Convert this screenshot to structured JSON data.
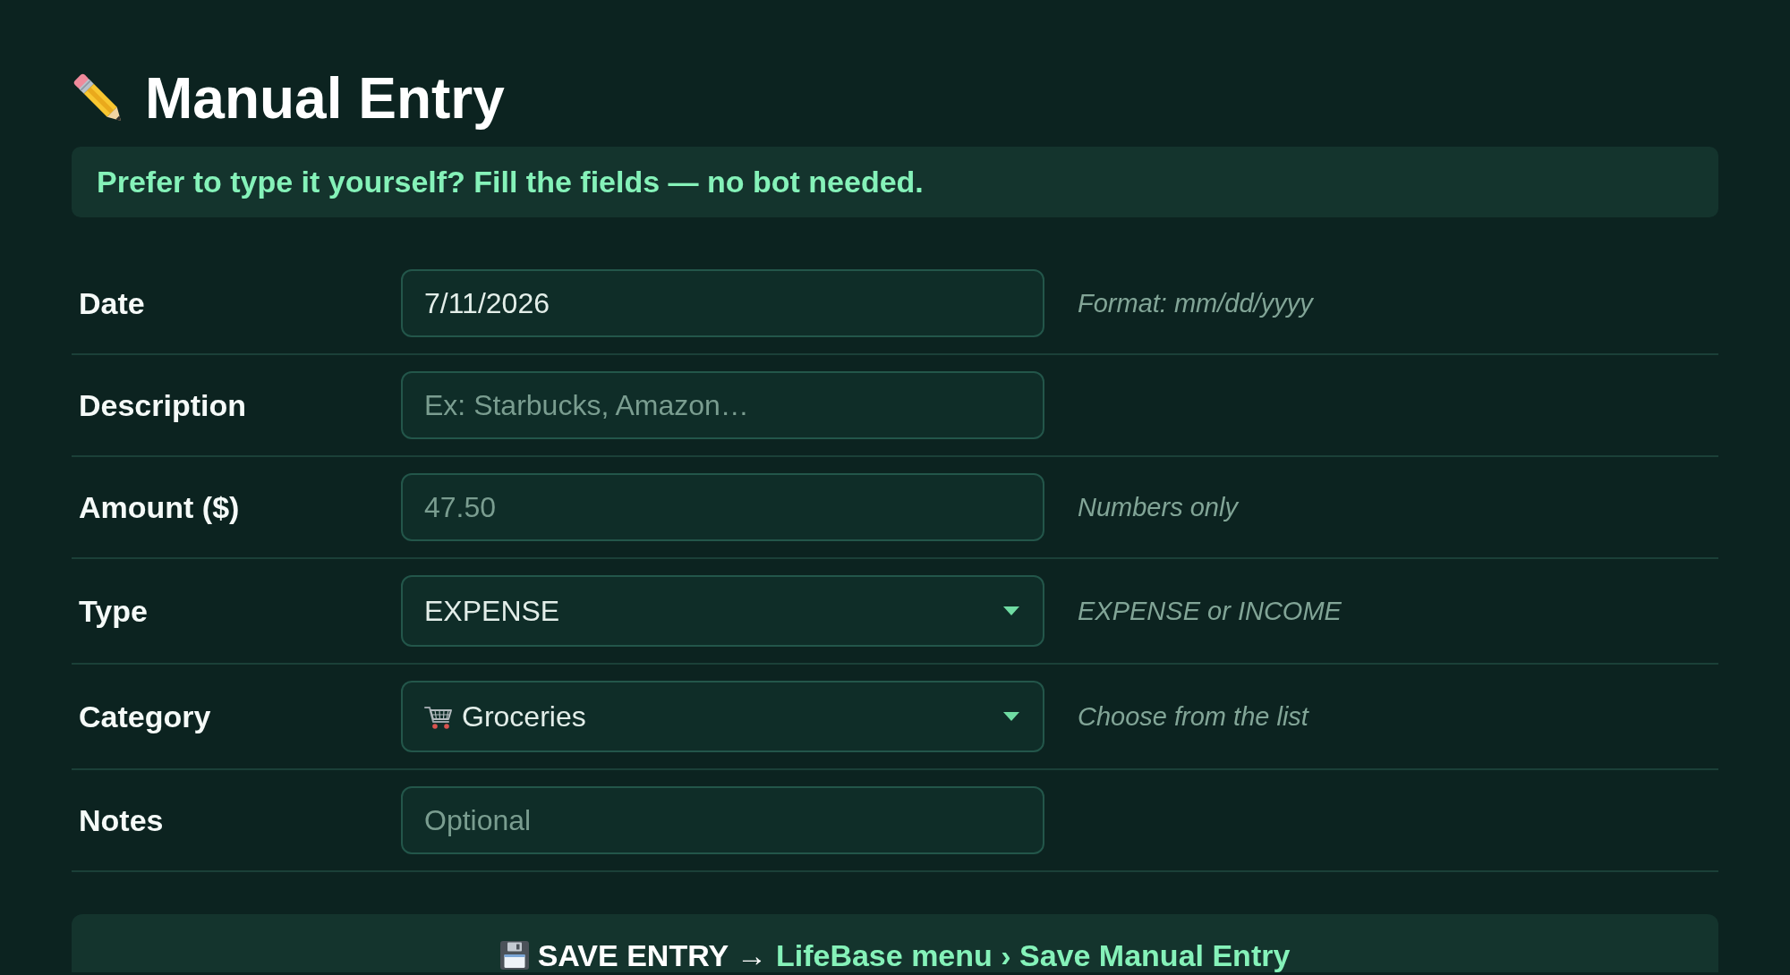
{
  "title": "Manual Entry",
  "banner": "Prefer to type it yourself? Fill the fields — no bot needed.",
  "fields": [
    {
      "kind": "text",
      "label": "Date",
      "value": "7/11/2026",
      "hint": "Format: mm/dd/yyyy"
    },
    {
      "kind": "text",
      "label": "Description",
      "placeholder": "Ex: Starbucks, Amazon…"
    },
    {
      "kind": "text",
      "label": "Amount ($)",
      "placeholder": "47.50",
      "hint": "Numbers only"
    },
    {
      "kind": "select",
      "label": "Type",
      "value": "EXPENSE",
      "hint": "EXPENSE or INCOME"
    },
    {
      "kind": "category",
      "label": "Category",
      "value": "Groceries",
      "hint": "Choose from the list"
    },
    {
      "kind": "text",
      "label": "Notes",
      "placeholder": "Optional"
    }
  ],
  "save_bar": {
    "action": "SAVE ENTRY →",
    "menu_path": "LifeBase menu › Save Manual Entry"
  }
}
